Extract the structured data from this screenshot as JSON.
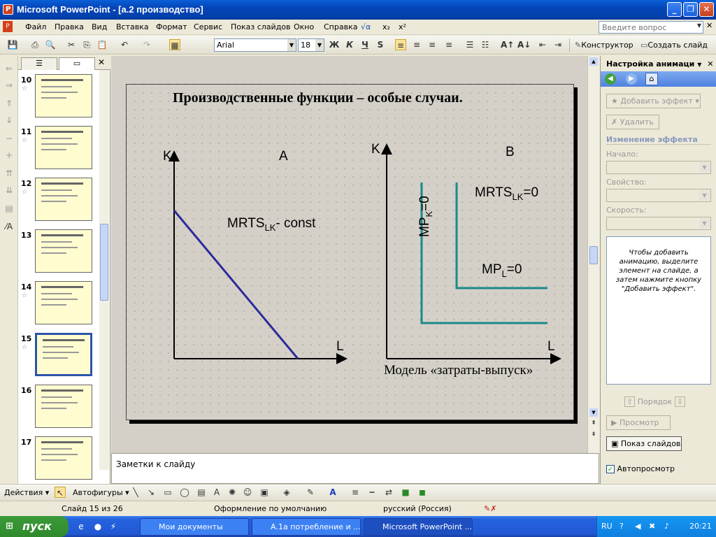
{
  "window": {
    "title": "Microsoft PowerPoint - [а.2 производство]"
  },
  "menu": {
    "items": [
      "Файл",
      "Правка",
      "Вид",
      "Вставка",
      "Формат",
      "Сервис",
      "Показ слайдов",
      "Окно",
      "Справка"
    ],
    "question_placeholder": "Введите вопрос"
  },
  "formatting": {
    "font": "Arial",
    "size": "18",
    "bold": "Ж",
    "italic": "К",
    "underline": "Ч",
    "shadow": "S",
    "designer": "Конструктор",
    "new_slide": "Создать слайд"
  },
  "thumbnails": [
    {
      "num": "10",
      "star": "☆"
    },
    {
      "num": "11",
      "star": "☆"
    },
    {
      "num": "12",
      "star": "☆"
    },
    {
      "num": "13",
      "star": ""
    },
    {
      "num": "14",
      "star": "☆"
    },
    {
      "num": "15",
      "star": "☆",
      "selected": true
    },
    {
      "num": "16",
      "star": ""
    },
    {
      "num": "17",
      "star": ""
    }
  ],
  "slide": {
    "title": "Производственные функции – особые случаи.",
    "graphA": {
      "y_axis": "K",
      "x_axis": "L",
      "label": "A",
      "mrts": "MRTS",
      "mrts_sub": "LK",
      "mrts_rest": "- const"
    },
    "graphB": {
      "y_axis": "K",
      "x_axis": "L",
      "label": "B",
      "mrts": "MRTS",
      "mrts_sub": "LK",
      "mrts_rest": "=0",
      "mpk": "MP",
      "mpk_sub": "K",
      "mpk_rest": "=0",
      "mpl": "MP",
      "mpl_sub": "L",
      "mpl_rest": "=0"
    },
    "caption": "Модель «затраты-выпуск»",
    "colors": {
      "lineA": "#2b2b9a",
      "lineB": "#1a8a8a",
      "bg": "#fffec5"
    }
  },
  "notes": {
    "placeholder": "Заметки к слайду"
  },
  "taskpane": {
    "title": "Настройка анимаци",
    "add_effect": "Добавить эффект",
    "delete": "Удалить",
    "change_effect": "Изменение эффекта",
    "start": "Начало:",
    "property": "Свойство:",
    "speed": "Скорость:",
    "hint": "Чтобы добавить анимацию, выделите элемент на слайде, а затем нажмите кнопку \"Добавить эффект\".",
    "order": "Порядок",
    "preview": "Просмотр",
    "slideshow": "Показ слайдов",
    "autopreview": "Автопросмотр"
  },
  "drawing": {
    "actions": "Действия",
    "autoshapes": "Автофигуры"
  },
  "status": {
    "slide": "Слайд 15 из 26",
    "design": "Оформление по умолчанию",
    "lang": "русский (Россия)"
  },
  "taskbar": {
    "start": "пуск",
    "tasks": [
      "Мои документы",
      "А.1а потребление и ...",
      "Microsoft PowerPoint ..."
    ],
    "lang": "RU",
    "time": "20:21"
  }
}
